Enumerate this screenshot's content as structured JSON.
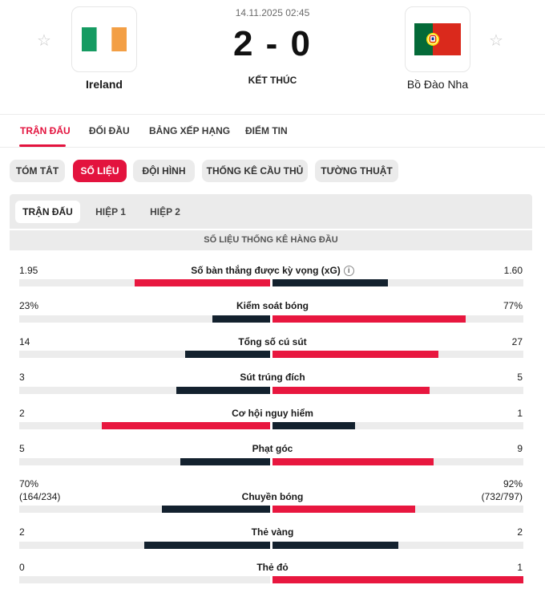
{
  "match": {
    "datetime": "14.11.2025 02:45",
    "score": "2 - 0",
    "status": "KẾT THÚC",
    "home": {
      "name": "Ireland",
      "flag_icon": "ireland-flag-icon"
    },
    "away": {
      "name": "Bồ Đào Nha",
      "flag_icon": "portugal-flag-icon"
    },
    "favorite_icon": "star-outline-icon"
  },
  "main_tabs": [
    {
      "label": "TRẬN ĐẤU",
      "active": true
    },
    {
      "label": "ĐỐI ĐẦU",
      "active": false
    },
    {
      "label": "BẢNG XẾP HẠNG",
      "active": false
    },
    {
      "label": "ĐIỂM TIN",
      "active": false
    }
  ],
  "sub_tabs": [
    {
      "label": "TÓM TẮT",
      "active": false
    },
    {
      "label": "SỐ LIỆU",
      "active": true
    },
    {
      "label": "ĐỘI HÌNH",
      "active": false
    },
    {
      "label": "THỐNG KÊ CẦU THỦ",
      "active": false
    },
    {
      "label": "TƯỜNG THUẬT",
      "active": false
    }
  ],
  "period_tabs": [
    {
      "label": "TRẬN ĐẤU",
      "active": true
    },
    {
      "label": "HIỆP 1",
      "active": false
    },
    {
      "label": "HIỆP 2",
      "active": false
    }
  ],
  "section_title": "SỐ LIỆU THỐNG KÊ HÀNG ĐẦU",
  "colors": {
    "accent": "#e3133e",
    "bar_red": "#e8173f",
    "bar_navy": "#13212e",
    "track": "#ececec"
  },
  "stats": [
    {
      "name": "Số bàn thắng được kỳ vọng (xG)",
      "home": "1.95",
      "away": "1.60",
      "home_fraction": 0.54,
      "away_fraction": 0.46,
      "info_icon": "info-circle-icon"
    },
    {
      "name": "Kiểm soát bóng",
      "home": "23%",
      "away": "77%",
      "home_fraction": 0.23,
      "away_fraction": 0.77
    },
    {
      "name": "Tổng số cú sút",
      "home": "14",
      "away": "27",
      "home_fraction": 0.34,
      "away_fraction": 0.66
    },
    {
      "name": "Sút trúng đích",
      "home": "3",
      "away": "5",
      "home_fraction": 0.375,
      "away_fraction": 0.625
    },
    {
      "name": "Cơ hội nguy hiểm",
      "home": "2",
      "away": "1",
      "home_fraction": 0.67,
      "away_fraction": 0.33
    },
    {
      "name": "Phạt góc",
      "home": "5",
      "away": "9",
      "home_fraction": 0.357,
      "away_fraction": 0.643
    },
    {
      "name": "Chuyền bóng",
      "home": "70%",
      "away": "92%",
      "home_sub": "(164/234)",
      "away_sub": "(732/797)",
      "home_fraction": 0.43,
      "away_fraction": 0.57
    },
    {
      "name": "Thẻ vàng",
      "home": "2",
      "away": "2",
      "home_fraction": 0.5,
      "away_fraction": 0.5
    },
    {
      "name": "Thẻ đỏ",
      "home": "0",
      "away": "1",
      "home_fraction": 0.0,
      "away_fraction": 1.0
    }
  ]
}
